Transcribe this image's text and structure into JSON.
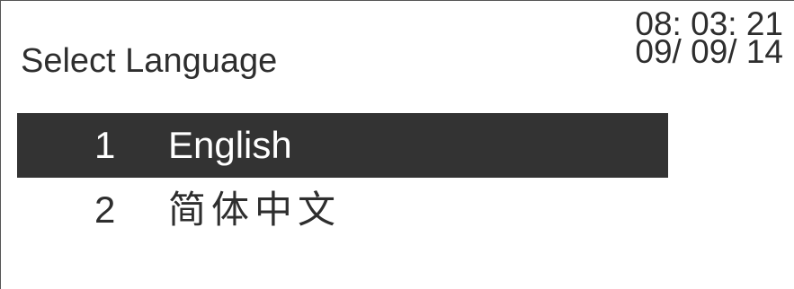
{
  "screen": {
    "title": "Select Language",
    "clock": {
      "time": "08: 03: 21",
      "date": "09/ 09/ 14"
    }
  },
  "menu": {
    "items": [
      {
        "number": "1",
        "label": "English",
        "selected": true
      },
      {
        "number": "2",
        "label": "简体中文",
        "selected": false
      }
    ]
  },
  "colors": {
    "background": "#ffffff",
    "text": "#2e2e2e",
    "highlight_background": "#333333",
    "highlight_text": "#ffffff"
  }
}
